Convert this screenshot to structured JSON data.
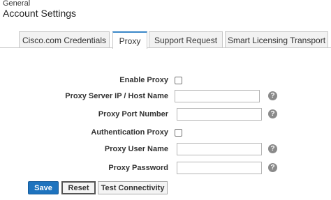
{
  "header": {
    "breadcrumb": "General",
    "title": "Account Settings"
  },
  "tabs": [
    {
      "label": "Cisco.com Credentials",
      "active": false
    },
    {
      "label": "Proxy",
      "active": true
    },
    {
      "label": "Support Request",
      "active": false
    },
    {
      "label": "Smart Licensing Transport",
      "active": false
    }
  ],
  "form": {
    "enable_proxy": {
      "label": "Enable Proxy",
      "checked": false
    },
    "proxy_server": {
      "label": "Proxy Server IP / Host Name",
      "value": "",
      "help_icon": "question-icon"
    },
    "proxy_port": {
      "label": "Proxy Port Number",
      "value": "",
      "help_icon": "question-icon"
    },
    "authentication_proxy": {
      "label": "Authentication Proxy",
      "checked": false
    },
    "proxy_user": {
      "label": "Proxy User Name",
      "value": "",
      "help_icon": "question-icon"
    },
    "proxy_password": {
      "label": "Proxy Password",
      "value": "",
      "help_icon": "question-icon"
    }
  },
  "buttons": {
    "save": "Save",
    "reset": "Reset",
    "test": "Test Connectivity"
  },
  "help_glyph": "?",
  "colors": {
    "accent": "#1e73be",
    "active_tab_border": "#3a87c8",
    "help_icon": "#8a8a8a"
  }
}
